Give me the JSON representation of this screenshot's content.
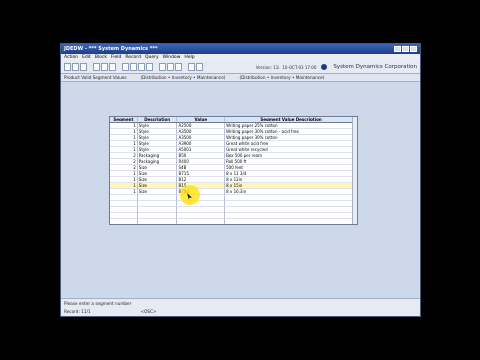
{
  "window": {
    "title": "JDEDW - *** System Dynamics ***"
  },
  "menu": [
    "Action",
    "Edit",
    "Block",
    "Field",
    "Record",
    "Query",
    "Window",
    "Help"
  ],
  "toolbar": {
    "buttons": [
      "save",
      "print",
      "exit",
      "cut",
      "copy",
      "paste",
      "first",
      "prev",
      "next",
      "last",
      "insert",
      "delete",
      "clear",
      "find",
      "help"
    ],
    "version": "Version: 11i",
    "date": "10-OCT-03 17:00",
    "brand": "System Dynamics Corporation"
  },
  "form": {
    "title": "Product Valid Segment Values",
    "context1": "(Distribution • Inventory • Maintenance)",
    "context2": "(Distribution • Inventory • Maintenance)"
  },
  "grid": {
    "headers": [
      "Segment",
      "Description",
      "Value",
      "Segment Value Description"
    ],
    "rows": [
      [
        "1",
        "Style",
        "A2500",
        "Writing paper 25% cotton"
      ],
      [
        "1",
        "Style",
        "A3500",
        "Writing paper 30% cotton - acid free"
      ],
      [
        "1",
        "Style",
        "A3500",
        "Writing paper 30% cotton"
      ],
      [
        "1",
        "Style",
        "A3900",
        "Great white acid free"
      ],
      [
        "1",
        "Style",
        "A5001",
        "Great white recycled"
      ],
      [
        "2",
        "Packaging",
        "B50",
        "Box 500 per ream"
      ],
      [
        "2",
        "Packaging",
        "R400",
        "Roll 500 ft"
      ],
      [
        "2",
        "Size",
        "S4B",
        "500 feet"
      ],
      [
        "1",
        "Size",
        "B715",
        "8 x 11 3/4"
      ],
      [
        "1",
        "Size",
        "B12",
        "8 x 12in"
      ],
      [
        "1",
        "Size",
        "B15",
        "8 x 15in"
      ],
      [
        "1",
        "Size",
        "B700",
        "8 x 16.3in"
      ],
      [
        "",
        "",
        "",
        ""
      ],
      [
        "",
        "",
        "",
        ""
      ],
      [
        "",
        "",
        "",
        ""
      ],
      [
        "",
        "",
        "",
        ""
      ],
      [
        "",
        "",
        "",
        ""
      ],
      [
        "",
        "",
        "",
        ""
      ]
    ]
  },
  "status": {
    "message": "Please enter a segment number",
    "record": "Record: 11/1",
    "osc": "<OSC>"
  }
}
